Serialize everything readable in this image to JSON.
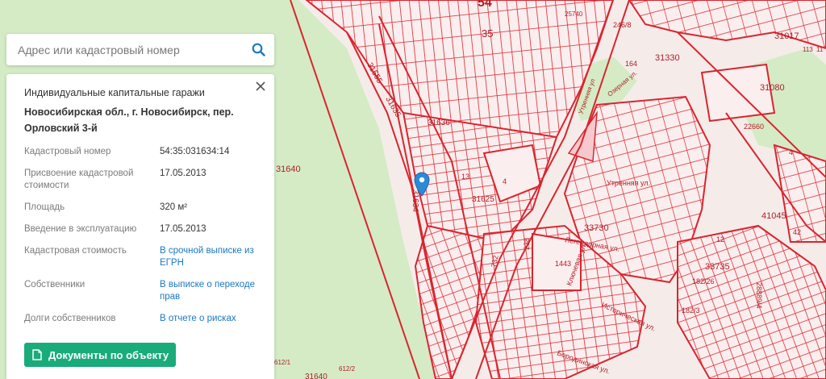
{
  "search": {
    "placeholder": "Адрес или кадастровый номер",
    "icon": "search-icon",
    "accent_color": "#1a78c2"
  },
  "panel": {
    "object_type": "Индивидуальные капитальные гаражи",
    "address": "Новосибирская обл., г. Новосибирск, пер. Орловский 3-й",
    "rows": [
      {
        "label": "Кадастровый номер",
        "value": "54:35:031634:14",
        "link": false
      },
      {
        "label": "Присвоение кадастровой стоимости",
        "value": "17.05.2013",
        "link": false
      },
      {
        "label": "Площадь",
        "value": "320 м²",
        "link": false
      },
      {
        "label": "Введение в эксплуатацию",
        "value": "17.05.2013",
        "link": false
      },
      {
        "label": "Кадастровая стоимость",
        "value": "В срочной выписке из ЕГРН",
        "link": true
      },
      {
        "label": "Собственники",
        "value": "В выписке о переходе прав",
        "link": true
      },
      {
        "label": "Долги собственников",
        "value": "В отчете о рисках",
        "link": true
      }
    ],
    "documents_button": "Документы по объекту",
    "button_color": "#1aab7a",
    "link_color": "#1a78c2"
  },
  "map": {
    "marker_color": "#2b8ad8",
    "parcel_color": "#d9252f",
    "forest_color": "#d6ecc9",
    "labels": [
      "54",
      "35",
      "31555",
      "31635",
      "31636",
      "31634",
      "31640",
      "31625",
      "13",
      "4",
      "25740",
      "246/8",
      "164",
      "31330",
      "31017",
      "31080",
      "22660",
      "4",
      "41045",
      "42",
      "12",
      "33735",
      "182/26",
      "28889/4",
      "182/3",
      "33730",
      "1443",
      "238",
      "732",
      "Утренняя ул.",
      "Легендарная ул.",
      "Ключевая ул.",
      "Историческая ул.",
      "Бородинская ул.",
      "Озерная ул.",
      "Утренняя ул",
      "612/1",
      "612/2",
      "31640",
      "113",
      "11"
    ]
  }
}
